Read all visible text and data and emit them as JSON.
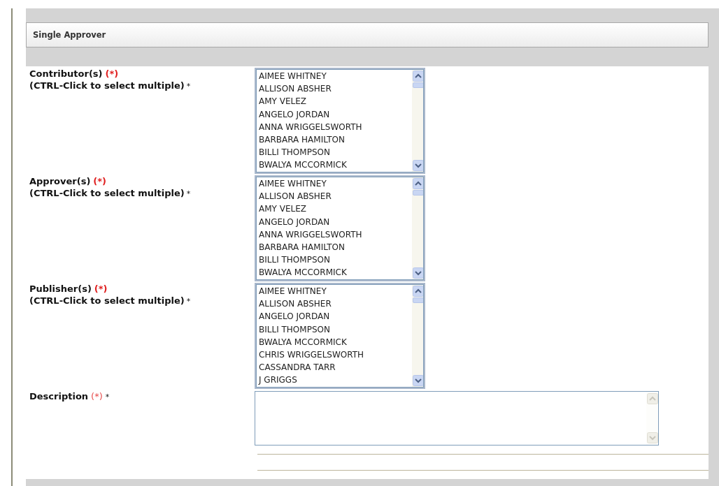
{
  "panel": {
    "title": "Single Approver"
  },
  "fields": [
    {
      "kind": "multiselect",
      "label": "Contributor(s)",
      "required": "(*)",
      "hint": "(CTRL-Click to select multiple)",
      "asterisk": "*",
      "options": [
        "AIMEE WHITNEY",
        "ALLISON ABSHER",
        "AMY VELEZ",
        "ANGELO JORDAN",
        "ANNA WRIGGELSWORTH",
        "BARBARA HAMILTON",
        "BILLI THOMPSON",
        "BWALYA MCCORMICK"
      ]
    },
    {
      "kind": "multiselect",
      "label": "Approver(s)",
      "required": "(*)",
      "hint": "(CTRL-Click to select multiple)",
      "asterisk": "*",
      "options": [
        "AIMEE WHITNEY",
        "ALLISON ABSHER",
        "AMY VELEZ",
        "ANGELO JORDAN",
        "ANNA WRIGGELSWORTH",
        "BARBARA HAMILTON",
        "BILLI THOMPSON",
        "BWALYA MCCORMICK"
      ]
    },
    {
      "kind": "multiselect",
      "label": "Publisher(s)",
      "required": "(*)",
      "hint": "(CTRL-Click to select multiple)",
      "asterisk": "*",
      "options": [
        "AIMEE WHITNEY",
        "ALLISON ABSHER",
        "ANGELO JORDAN",
        "BILLI THOMPSON",
        "BWALYA MCCORMICK",
        "CHRIS WRIGGELSWORTH",
        "CASSANDRA TARR",
        "J GRIGGS"
      ]
    },
    {
      "kind": "textarea",
      "label": "Description",
      "required": "(*)",
      "asterisk": "*"
    }
  ]
}
